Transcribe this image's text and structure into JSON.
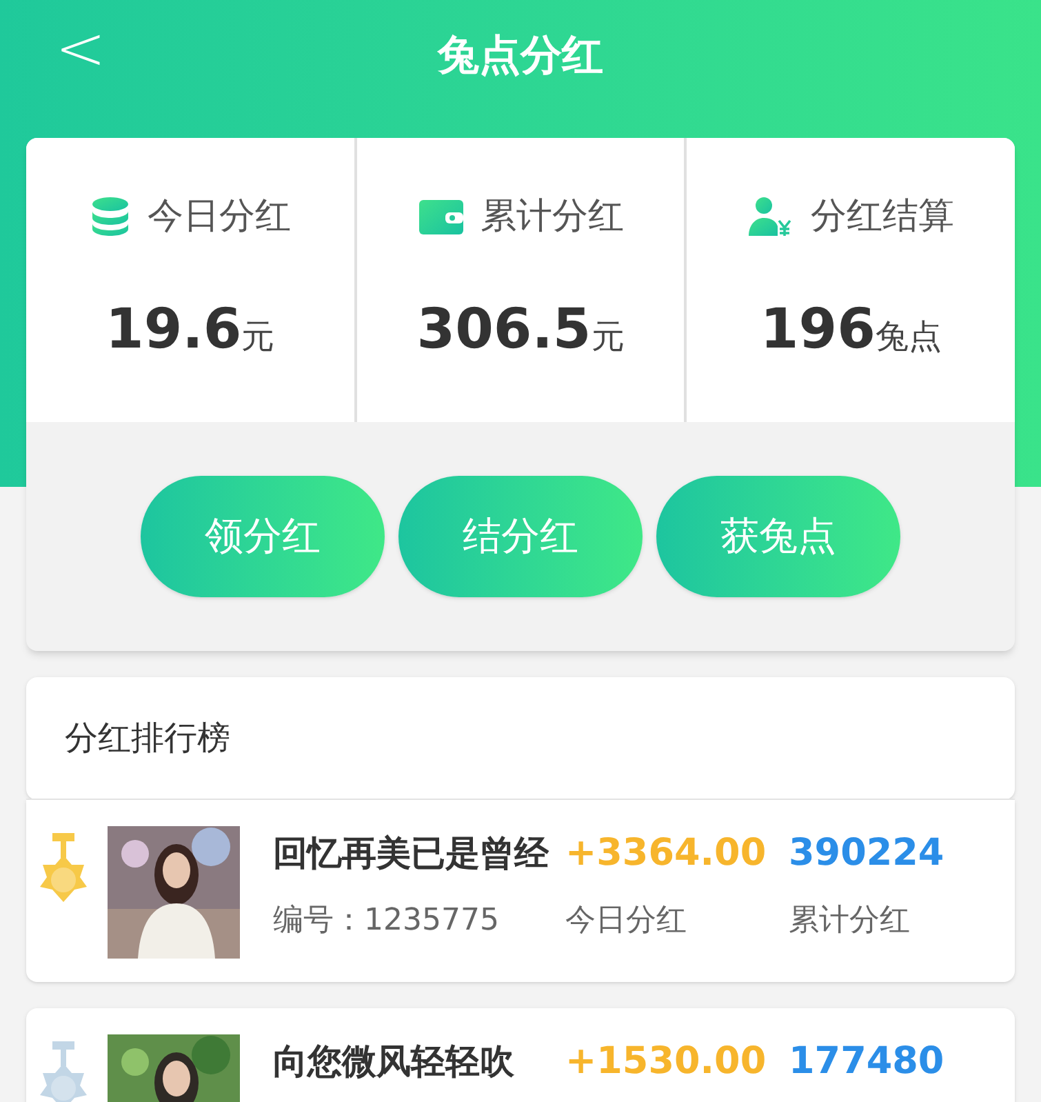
{
  "header": {
    "back": "<",
    "title": "兔点分红"
  },
  "stats": [
    {
      "kind": "coins",
      "label": "今日分红",
      "value": "19.6",
      "unit": "元"
    },
    {
      "kind": "wallet",
      "label": "累计分红",
      "value": "306.5",
      "unit": "元"
    },
    {
      "kind": "user",
      "label": "分红结算",
      "value": "196",
      "unit": "兔点"
    }
  ],
  "buttons": [
    "领分红",
    "结分红",
    "获兔点"
  ],
  "ranking": {
    "title": "分红排行榜",
    "rows": [
      {
        "color": "#f7c948",
        "name": "回忆再美已是曾经",
        "today": "+3364.00",
        "total": "390224",
        "id_label": "编号：",
        "id": "1235775",
        "today_label": "今日分红",
        "total_label": "累计分红"
      },
      {
        "color": "#c2d6e6",
        "name": "向您微风轻轻吹",
        "today": "+1530.00",
        "total": "177480"
      }
    ]
  }
}
